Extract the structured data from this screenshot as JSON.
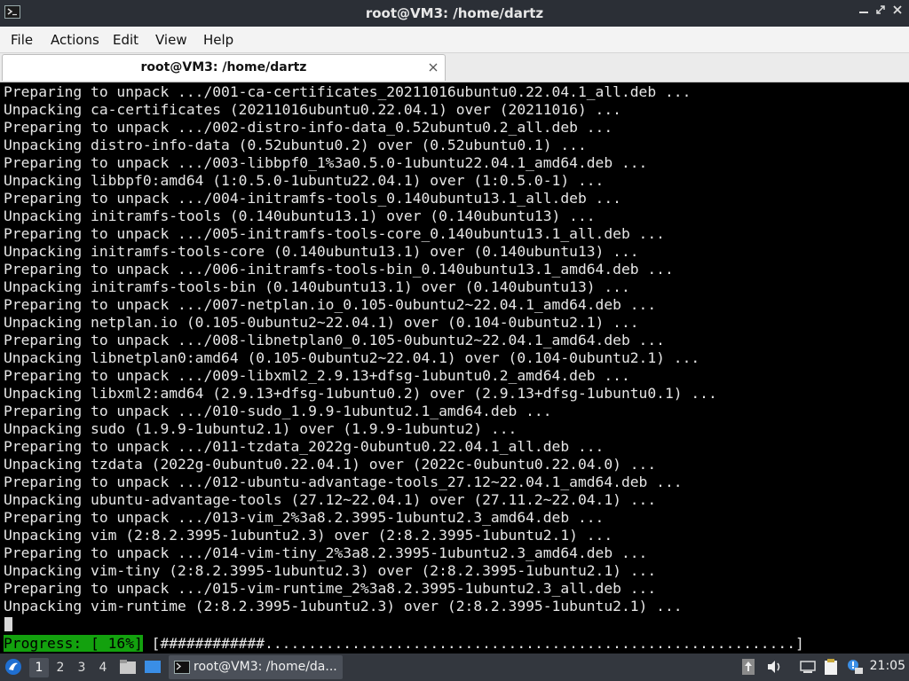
{
  "window": {
    "title": "root@VM3: /home/dartz",
    "controls": {
      "minimize": "▬",
      "maximize": "⤡",
      "close": "✕"
    }
  },
  "menu": [
    "File",
    "Actions",
    "Edit",
    "View",
    "Help"
  ],
  "tab": {
    "label": "root@VM3: /home/dartz",
    "close": "✕"
  },
  "terminal": {
    "lines": [
      "Preparing to unpack .../001-ca-certificates_20211016ubuntu0.22.04.1_all.deb ...",
      "Unpacking ca-certificates (20211016ubuntu0.22.04.1) over (20211016) ...",
      "Preparing to unpack .../002-distro-info-data_0.52ubuntu0.2_all.deb ...",
      "Unpacking distro-info-data (0.52ubuntu0.2) over (0.52ubuntu0.1) ...",
      "Preparing to unpack .../003-libbpf0_1%3a0.5.0-1ubuntu22.04.1_amd64.deb ...",
      "Unpacking libbpf0:amd64 (1:0.5.0-1ubuntu22.04.1) over (1:0.5.0-1) ...",
      "Preparing to unpack .../004-initramfs-tools_0.140ubuntu13.1_all.deb ...",
      "Unpacking initramfs-tools (0.140ubuntu13.1) over (0.140ubuntu13) ...",
      "Preparing to unpack .../005-initramfs-tools-core_0.140ubuntu13.1_all.deb ...",
      "Unpacking initramfs-tools-core (0.140ubuntu13.1) over (0.140ubuntu13) ...",
      "Preparing to unpack .../006-initramfs-tools-bin_0.140ubuntu13.1_amd64.deb ...",
      "Unpacking initramfs-tools-bin (0.140ubuntu13.1) over (0.140ubuntu13) ...",
      "Preparing to unpack .../007-netplan.io_0.105-0ubuntu2~22.04.1_amd64.deb ...",
      "Unpacking netplan.io (0.105-0ubuntu2~22.04.1) over (0.104-0ubuntu2.1) ...",
      "Preparing to unpack .../008-libnetplan0_0.105-0ubuntu2~22.04.1_amd64.deb ...",
      "Unpacking libnetplan0:amd64 (0.105-0ubuntu2~22.04.1) over (0.104-0ubuntu2.1) ...",
      "Preparing to unpack .../009-libxml2_2.9.13+dfsg-1ubuntu0.2_amd64.deb ...",
      "Unpacking libxml2:amd64 (2.9.13+dfsg-1ubuntu0.2) over (2.9.13+dfsg-1ubuntu0.1) ...",
      "Preparing to unpack .../010-sudo_1.9.9-1ubuntu2.1_amd64.deb ...",
      "Unpacking sudo (1.9.9-1ubuntu2.1) over (1.9.9-1ubuntu2) ...",
      "Preparing to unpack .../011-tzdata_2022g-0ubuntu0.22.04.1_all.deb ...",
      "Unpacking tzdata (2022g-0ubuntu0.22.04.1) over (2022c-0ubuntu0.22.04.0) ...",
      "Preparing to unpack .../012-ubuntu-advantage-tools_27.12~22.04.1_amd64.deb ...",
      "Unpacking ubuntu-advantage-tools (27.12~22.04.1) over (27.11.2~22.04.1) ...",
      "Preparing to unpack .../013-vim_2%3a8.2.3995-1ubuntu2.3_amd64.deb ...",
      "Unpacking vim (2:8.2.3995-1ubuntu2.3) over (2:8.2.3995-1ubuntu2.1) ...",
      "Preparing to unpack .../014-vim-tiny_2%3a8.2.3995-1ubuntu2.3_amd64.deb ...",
      "Unpacking vim-tiny (2:8.2.3995-1ubuntu2.3) over (2:8.2.3995-1ubuntu2.1) ...",
      "Preparing to unpack .../015-vim-runtime_2%3a8.2.3995-1ubuntu2.3_all.deb ...",
      "Unpacking vim-runtime (2:8.2.3995-1ubuntu2.3) over (2:8.2.3995-1ubuntu2.1) ..."
    ],
    "progress_label": "Progress: [ 16%]",
    "progress_bar": " [############.............................................................]",
    "progress_percent": 16
  },
  "taskbar": {
    "workspaces": [
      "1",
      "2",
      "3",
      "4"
    ],
    "active_workspace": "1",
    "task_label": "root@VM3: /home/da...",
    "clock": "21:05",
    "tray_icons": [
      "upload-icon",
      "volume-icon",
      "network-icon",
      "clipboard-icon",
      "notification-icon"
    ]
  },
  "colors": {
    "progress_green": "#13a10e",
    "titlebar": "#2b2f36",
    "taskbar": "#33373e"
  }
}
